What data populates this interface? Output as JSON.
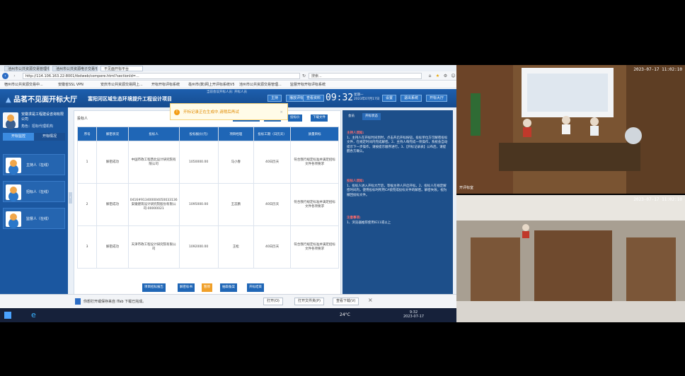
{
  "browser": {
    "tabs": [
      "池州市公共资源交易管理中心",
      "池州市公共资源电子交易平台",
      "不见面开标平台"
    ],
    "url": "http://114.106.163.22:8001/tbdweb/compere.html?sectionId=...",
    "search_placeholder": "搜索...",
    "favorites": [
      "宿州市公共资源交易中...",
      "安徽省SSL VPN",
      "安庆市公共资源交易网上...",
      "开标开标评标系统",
      "亳州市(数)网上开评标系统V5",
      "池州市公共资源交易管理...",
      "监督开标开标评标系统"
    ]
  },
  "app": {
    "logo": "品茗不见面开标大厅",
    "project_title": "富阳河区域生态环境提升工程设计项目",
    "top_info": "当前会议开标人员: 开标人员",
    "header_buttons": [
      "主持",
      "播放评标",
      "查看资料"
    ],
    "clock": "09:32",
    "date_line1": "星期一",
    "date_line2": "2023年07月17日",
    "right_buttons": [
      "设置",
      "退出系统",
      "开标大厅"
    ]
  },
  "left": {
    "org_name": "安徽求是工程建设咨询有限公司",
    "role": "角色：招标代理机构",
    "tabs": [
      "开标监控",
      "开标情况"
    ],
    "persons": [
      "主持人（在线）",
      "招标人（在线）",
      "监督人（在线）"
    ]
  },
  "center": {
    "title": "投标人",
    "tools": [
      "查看开标记录表",
      "公布报价",
      "投标价",
      "下载文件"
    ],
    "columns": [
      "序号",
      "解密状况",
      "投标人",
      "投标报价(元)",
      "项目经理",
      "投标工期（日历天）",
      "质量目标"
    ],
    "rows": [
      [
        "1",
        "解密成功",
        "中国市政工程西北设计研究院有限公司",
        "1050000.00",
        "马小春",
        "40日历天",
        "符合我行规定标准并满足招标文件各项要求"
      ],
      [
        "2",
        "解密成功",
        "0416#913400004050033136安徽建筑设计研究院股份有限公司-00000021",
        "1095000.00",
        "王志鹏",
        "40日历天",
        "符合我行规定标准并满足招标文件各项要求"
      ],
      [
        "3",
        "解密成功",
        "天津市政工程设计研究院有限公司",
        "1092000.00",
        "王松",
        "40日历天",
        "符合我行规定标准并满足招标文件各项要求"
      ]
    ],
    "actions": [
      "项目招标报告",
      "解密标书",
      "暂停",
      "抽取备案",
      "开标结束"
    ]
  },
  "right": {
    "tabs": [
      "会员",
      "开标状态"
    ],
    "sections": [
      {
        "head": "主持人须知:",
        "body": "1、主持人在开标时间到时，点击开启开标按钮，投标单位方可解密投标文件，在规定时间内完成解密。2、主持人每完成一项操作，系统会自动提示下一步操作，请按提示顺序进行。3、【开标记录表】公布后，请提醒各方确认。"
      },
      {
        "head": "投标人须知:",
        "body": "1、投标人进入开标大厅后，等候主持人开启开标。2、投标人在规定解密时间内，使用投标时所用CA锁完成投标文件的解密。解密失败，视为撤回投标文件。"
      },
      {
        "head": "注意事项:",
        "body": "1、浏览器推荐使用IE11或以上"
      }
    ]
  },
  "toast": {
    "text": "开标记录正在生成中,请稍后再试"
  },
  "download": {
    "text": "你想打开或保存来自 ITab 下载已完成。",
    "buttons": [
      "打开(O)",
      "打开文件夹(P)",
      "查看下载(V)"
    ]
  },
  "taskbar": {
    "temp": "24°C",
    "time": "9:32",
    "date": "2023-07-17"
  },
  "video": {
    "timestamp1": "2023-07-17 11:02:10",
    "caption1": "开评标室",
    "timestamp2": "2023-07-17 11:02:10"
  },
  "colors": {
    "brand_blue": "#1d5fae",
    "table_header": "#1f66b6",
    "warning": "#f39c12",
    "notice_red": "#ff6b6b"
  }
}
